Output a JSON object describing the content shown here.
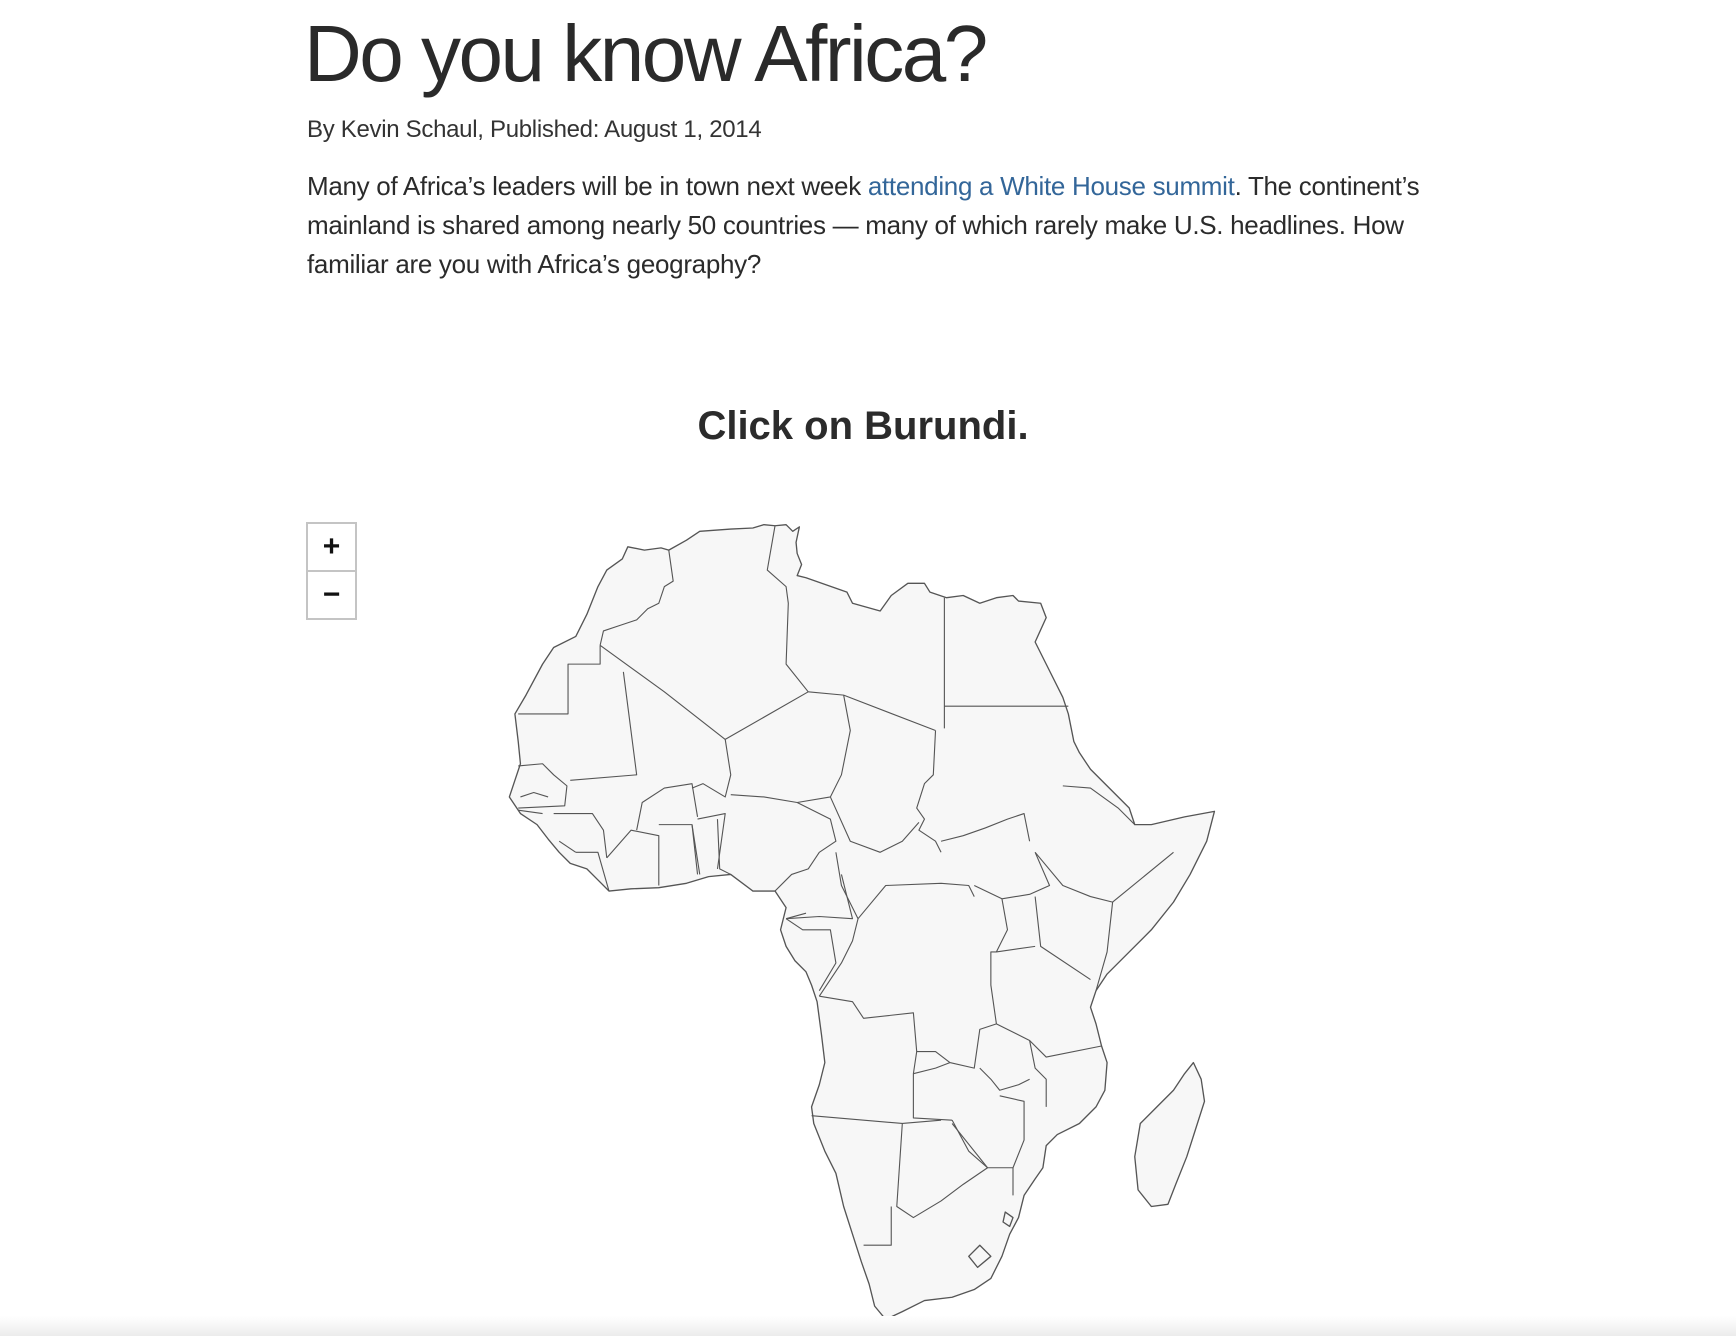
{
  "article": {
    "title": "Do you know Africa?",
    "byline": "By Kevin Schaul, Published: August 1, 2014",
    "intro_before_link": "Many of Africa’s leaders will be in town next week ",
    "intro_link": "attending a White House summit",
    "intro_after_link": ". The continent’s mainland is shared among nearly 50 countries — many of which rarely make U.S. headlines. How familiar are you with Africa’s geography?"
  },
  "quiz": {
    "prompt": "Click on Burundi."
  },
  "map_controls": {
    "zoom_in_label": "+",
    "zoom_out_label": "−"
  },
  "colors": {
    "text": "#333333",
    "link": "#336699",
    "country_fill": "#f7f7f7",
    "country_stroke": "#555555"
  }
}
